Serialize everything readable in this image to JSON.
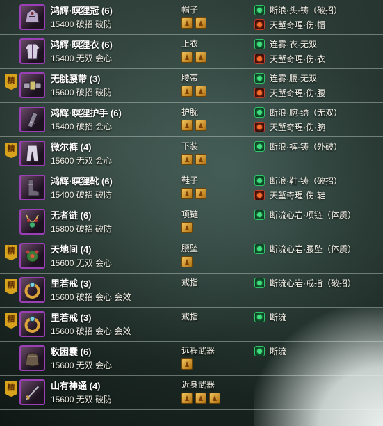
{
  "colors": {
    "badge": "#d9a21c",
    "icon_border": "#9a3fb6",
    "green_enh": "#3fe07e",
    "red_enh": "#ff6a2a",
    "gem": "#e0a53a"
  },
  "items": [
    {
      "badge": "",
      "name": "鸿辉·暝狸冠 (6)",
      "stats": "15400 破招 破防",
      "slot": "帽子",
      "gems": 2,
      "enh1": "断浪·头·铸（破招）",
      "enh2": "天堑奇瑆·伤·帽",
      "icon": "helmet-icon"
    },
    {
      "badge": "",
      "name": "鸿辉·暝狸衣 (6)",
      "stats": "15400 无双 会心",
      "slot": "上衣",
      "gems": 2,
      "enh1": "连雾·衣·无双",
      "enh2": "天堑奇瑆·伤·衣",
      "icon": "robe-icon"
    },
    {
      "badge": "精",
      "name": "无朓腰带 (3)",
      "stats": "15600 破招 破防",
      "slot": "腰带",
      "gems": 2,
      "enh1": "连雾·腰·无双",
      "enh2": "天堑奇瑆·伤·腰",
      "icon": "belt-icon"
    },
    {
      "badge": "",
      "name": "鸿辉·暝狸护手 (6)",
      "stats": "15400 破招 会心",
      "slot": "护腕",
      "gems": 2,
      "enh1": "断浪·腕·绣（无双）",
      "enh2": "天堑奇瑆·伤·腕",
      "icon": "bracer-icon"
    },
    {
      "badge": "精",
      "name": "微尔裤 (4)",
      "stats": "15600 无双 会心",
      "slot": "下装",
      "gems": 2,
      "enh1": "断浪·裤·铸（外破）",
      "enh2": "",
      "icon": "pants-icon"
    },
    {
      "badge": "",
      "name": "鸿辉·暝狸靴 (6)",
      "stats": "15400 破招 破防",
      "slot": "鞋子",
      "gems": 2,
      "enh1": "断浪·鞋·铸（破招）",
      "enh2": "天堑奇瑆·伤·鞋",
      "icon": "boots-icon"
    },
    {
      "badge": "",
      "name": "无者链 (6)",
      "stats": "15800 破招 破防",
      "slot": "项链",
      "gems": 1,
      "enh1": "断流心岩·项链（体质）",
      "enh2": "",
      "icon": "necklace-icon"
    },
    {
      "badge": "精",
      "name": "天地间 (4)",
      "stats": "15600 无双 会心",
      "slot": "腰坠",
      "gems": 1,
      "enh1": "断流心岩·腰坠（体质）",
      "enh2": "",
      "icon": "pendant-icon"
    },
    {
      "badge": "精",
      "name": "里若戒 (3)",
      "stats": "15600 破招 会心 会效",
      "slot": "戒指",
      "gems": 0,
      "enh1": "断流心岩·戒指（破招）",
      "enh2": "",
      "icon": "ring-icon"
    },
    {
      "badge": "精",
      "name": "里若戒 (3)",
      "stats": "15600 破招 会心 会效",
      "slot": "戒指",
      "gems": 0,
      "enh1": "断流",
      "enh2": "",
      "icon": "ring-icon"
    },
    {
      "badge": "",
      "name": "敉困囊 (6)",
      "stats": "15600 无双 会心",
      "slot": "远程武器",
      "gems": 1,
      "enh1": "断流",
      "enh2": "",
      "icon": "pouch-icon"
    },
    {
      "badge": "精",
      "name": "山有神通 (4)",
      "stats": "15600 无双 破防",
      "slot": "近身武器",
      "gems": 3,
      "enh1": "",
      "enh2": "",
      "icon": "weapon-icon"
    }
  ]
}
